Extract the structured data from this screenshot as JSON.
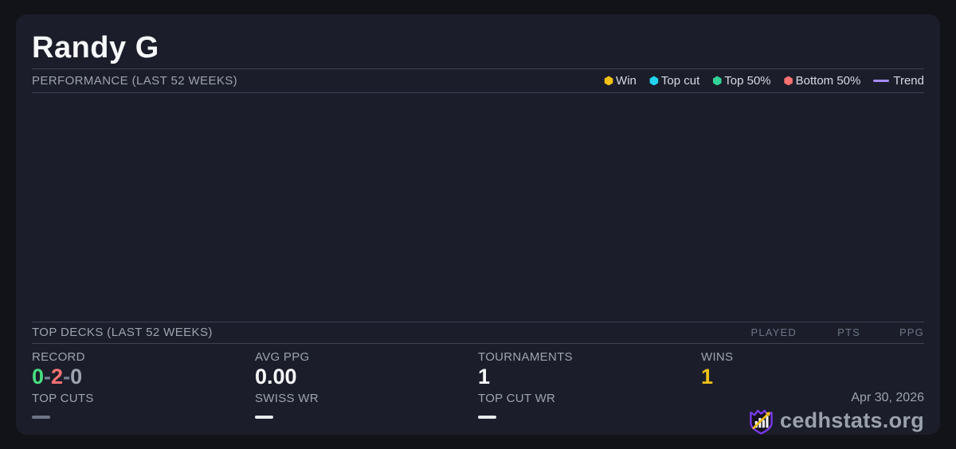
{
  "player": {
    "name": "Randy G"
  },
  "performance": {
    "title": "PERFORMANCE (LAST 52 WEEKS)",
    "legend": [
      {
        "label": "Win",
        "marker": "dot",
        "color": "#f2c115"
      },
      {
        "label": "Top cut",
        "marker": "dot",
        "color": "#22d3ee"
      },
      {
        "label": "Top 50%",
        "marker": "dot",
        "color": "#34d399"
      },
      {
        "label": "Bottom 50%",
        "marker": "dot",
        "color": "#f87171"
      },
      {
        "label": "Trend",
        "marker": "line",
        "color": "#a78bfa"
      }
    ],
    "chart_empty": true
  },
  "chart_data": {
    "type": "scatter",
    "title": "PERFORMANCE (LAST 52 WEEKS)",
    "series": [],
    "note_visible_points": "chart plot area is empty - no data points rendered"
  },
  "top_decks": {
    "title": "TOP DECKS (LAST 52 WEEKS)",
    "columns": [
      "PLAYED",
      "PTS",
      "PPG"
    ],
    "rows": []
  },
  "stats": {
    "record": {
      "label": "RECORD",
      "wins": "0",
      "losses": "2",
      "draws": "0",
      "separator": "-"
    },
    "avg_ppg": {
      "label": "AVG PPG",
      "value": "0.00"
    },
    "tournaments": {
      "label": "TOURNAMENTS",
      "value": "1"
    },
    "wins": {
      "label": "WINS",
      "value": "1"
    },
    "top_cuts": {
      "label": "TOP CUTS",
      "empty": true,
      "dash_color": "#6e7587"
    },
    "swiss_wr": {
      "label": "SWISS WR",
      "empty": true,
      "dash_color": "#e8eaee"
    },
    "top_cut_wr": {
      "label": "TOP CUT WR",
      "empty": true,
      "dash_color": "#e8eaee"
    }
  },
  "footer": {
    "date": "Apr 30, 2026",
    "brand": "cedhstats.org"
  },
  "colors": {
    "page_background": "#121319",
    "card_background": "#1b1e2a",
    "divider": "#3b4156",
    "label_gray": "#9ca3af",
    "column_header_gray": "#6e7587",
    "value_white": "#f7f8fa",
    "record_win_green": "#4ade80",
    "record_loss_red": "#f87171",
    "record_draw_gray": "#9ca3af",
    "wins_gold": "#eec118",
    "trend_purple": "#a78bfa",
    "logo_purple": "#7c3aed",
    "logo_arrow_gold": "#f2c115"
  }
}
